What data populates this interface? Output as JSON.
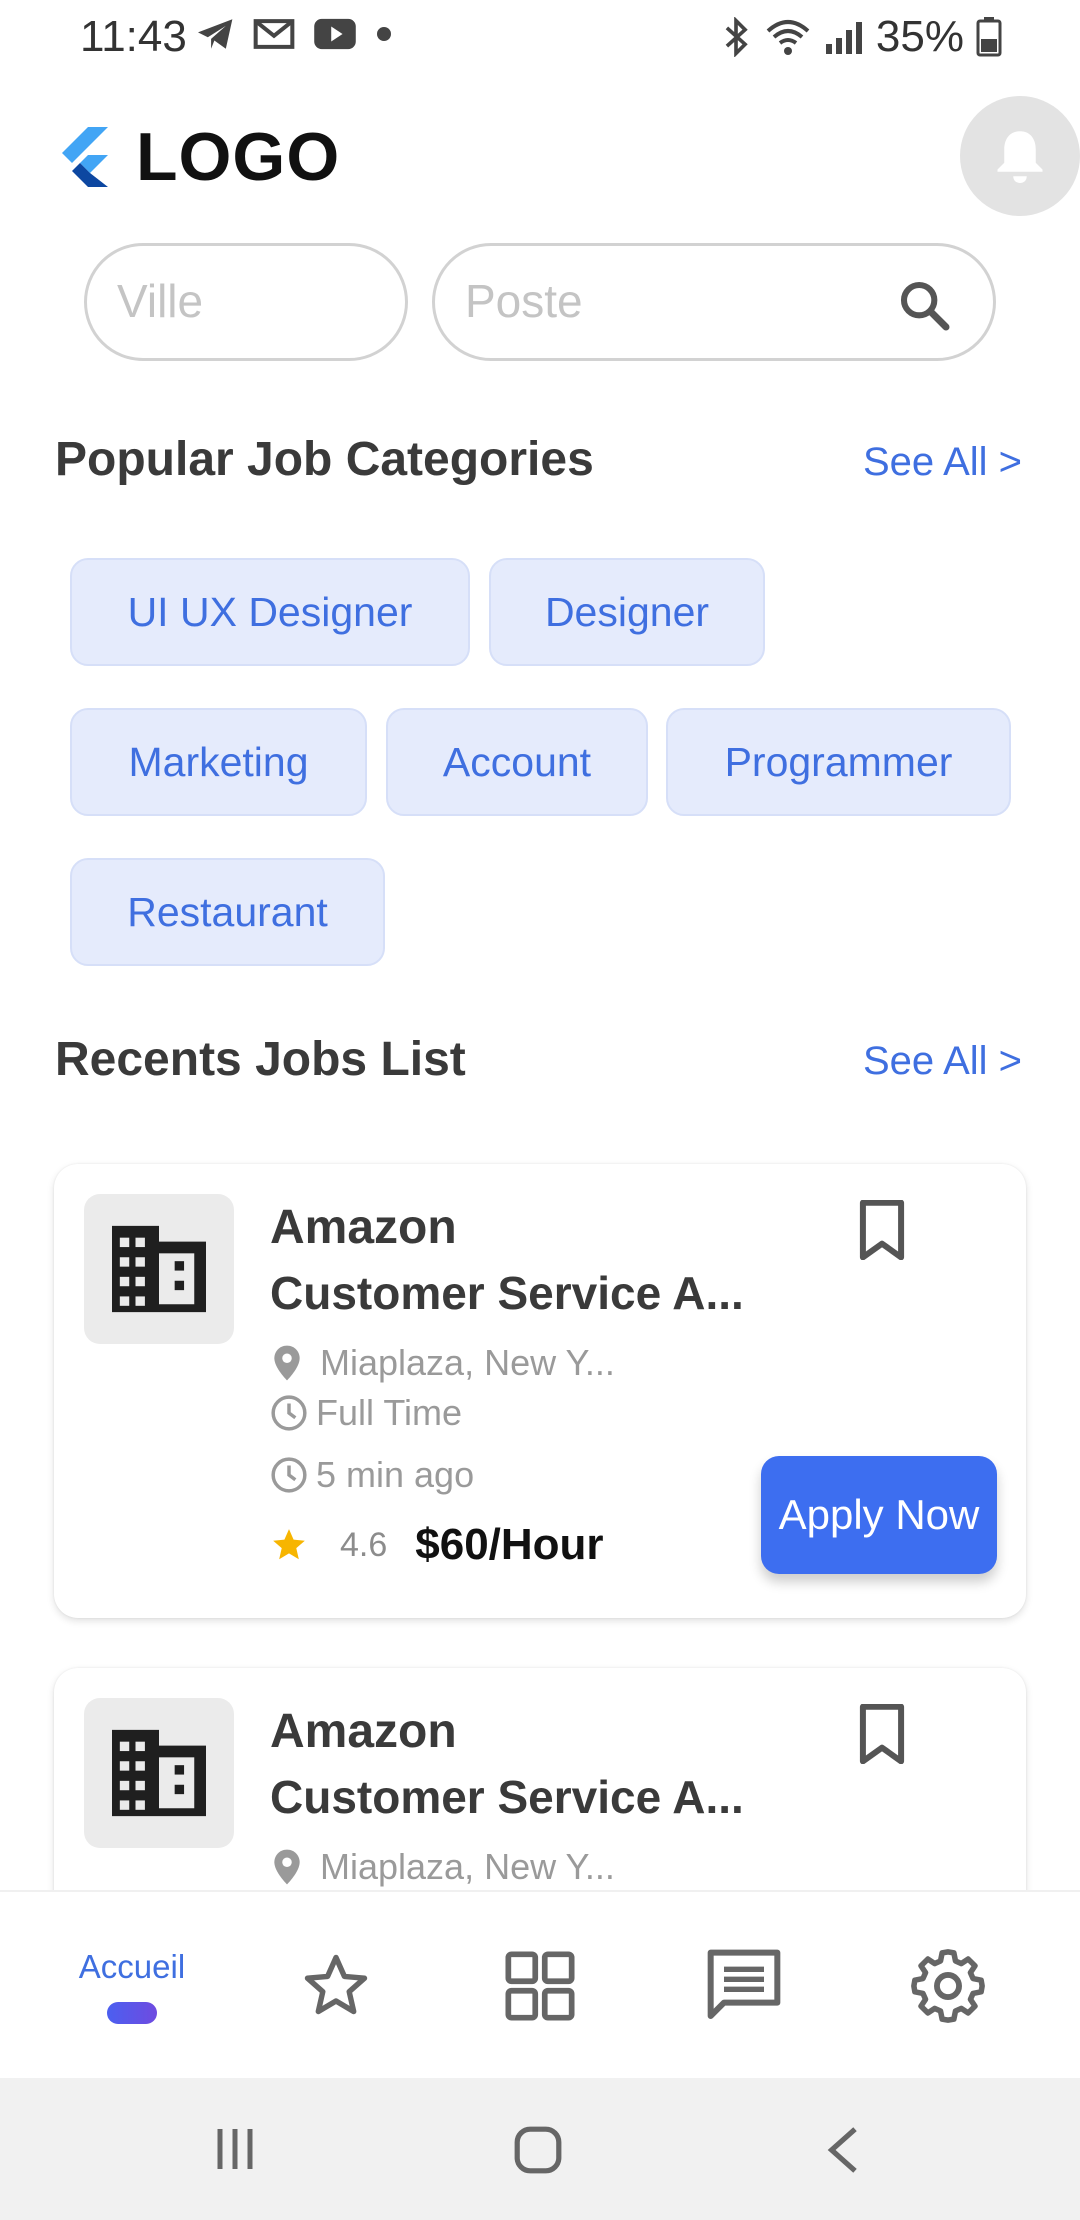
{
  "status_bar": {
    "time": "11:43",
    "battery": "35%",
    "icons_left": [
      "telegram-icon",
      "gmail-icon",
      "youtube-icon",
      "dot-icon"
    ],
    "icons_right": [
      "bluetooth-icon",
      "wifi-icon",
      "signal-icon",
      "battery-icon"
    ]
  },
  "header": {
    "logo_text": "LOGO",
    "notification_icon": "bell-icon"
  },
  "search": {
    "ville_placeholder": "Ville",
    "poste_placeholder": "Poste"
  },
  "categories": {
    "title": "Popular Job Categories",
    "see_all": "See All >",
    "chips": [
      "UI UX Designer",
      "Designer",
      "Marketing",
      "Account",
      "Programmer",
      "Restaurant"
    ]
  },
  "recents": {
    "title": "Recents Jobs List",
    "see_all": "See All >",
    "jobs": [
      {
        "company": "Amazon",
        "title": "Customer Service A...",
        "location": "Miaplaza, New Y...",
        "type": "Full Time",
        "posted": "5 min ago",
        "rating": "4.6",
        "salary": "$60/Hour",
        "apply_label": "Apply Now"
      },
      {
        "company": "Amazon",
        "title": "Customer Service A...",
        "location": "Miaplaza, New Y..."
      }
    ]
  },
  "bottom_nav": {
    "items": [
      {
        "label": "Accueil",
        "icon": "home",
        "active": true
      },
      {
        "icon": "star-icon"
      },
      {
        "icon": "grid-icon"
      },
      {
        "icon": "message-icon"
      },
      {
        "icon": "gear-icon"
      }
    ]
  },
  "colors": {
    "accent": "#3f6fe0",
    "apply_button": "#3d6ef0",
    "chip_bg": "#e5ebfc",
    "star": "#f7b500"
  }
}
